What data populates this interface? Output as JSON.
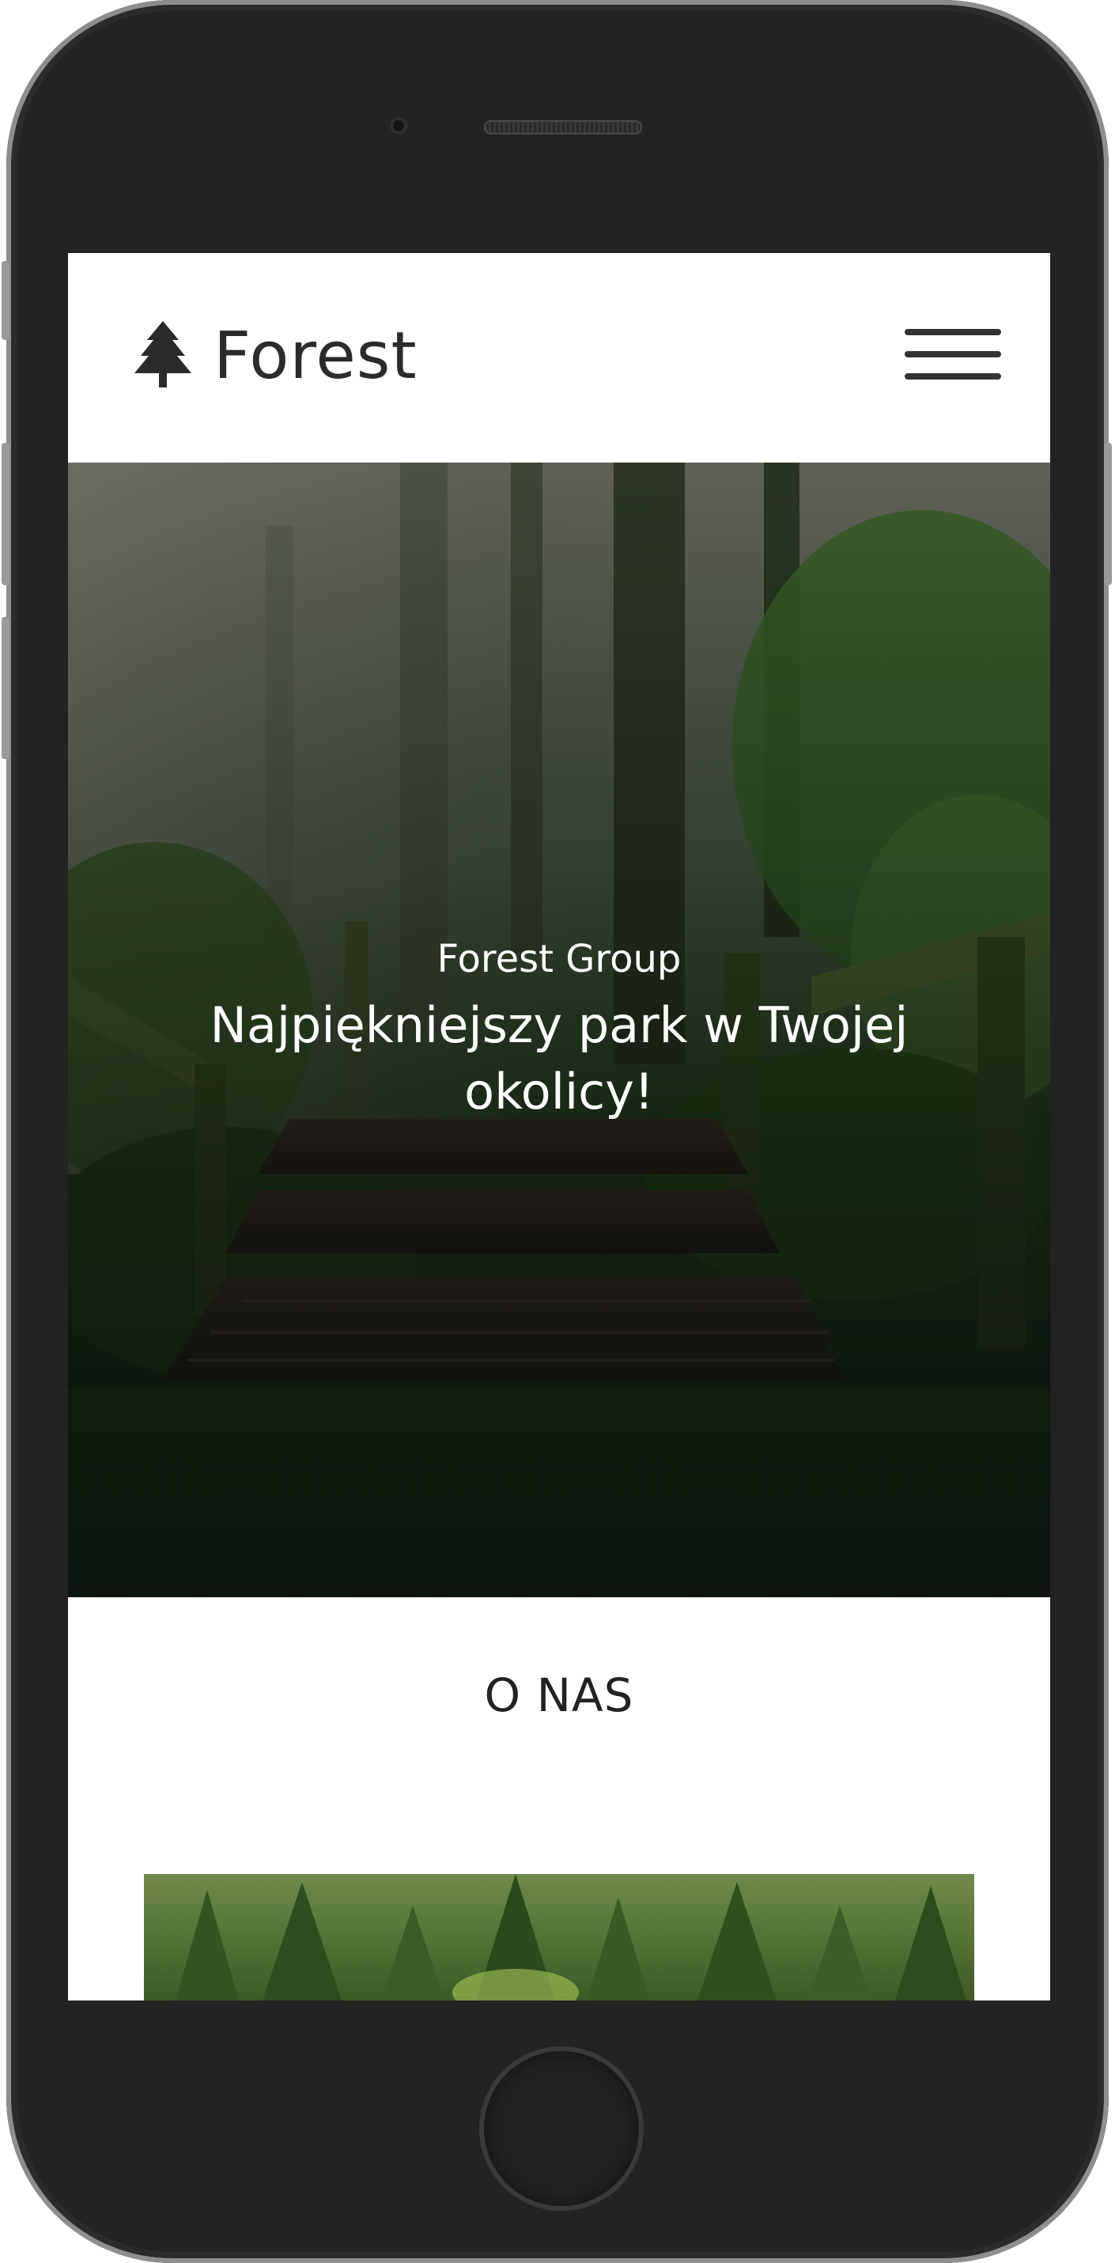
{
  "navbar": {
    "brand_text": "Forest",
    "brand_icon": "tree-icon",
    "menu_icon": "hamburger-menu-icon"
  },
  "hero": {
    "subtitle": "Forest Group",
    "title": "Najpiękniejszy park w Twojej okolicy!"
  },
  "about": {
    "heading": "O NAS"
  },
  "colors": {
    "brand_text": "#2b2b2b",
    "hero_text": "#ffffff",
    "device_body": "#232323"
  }
}
